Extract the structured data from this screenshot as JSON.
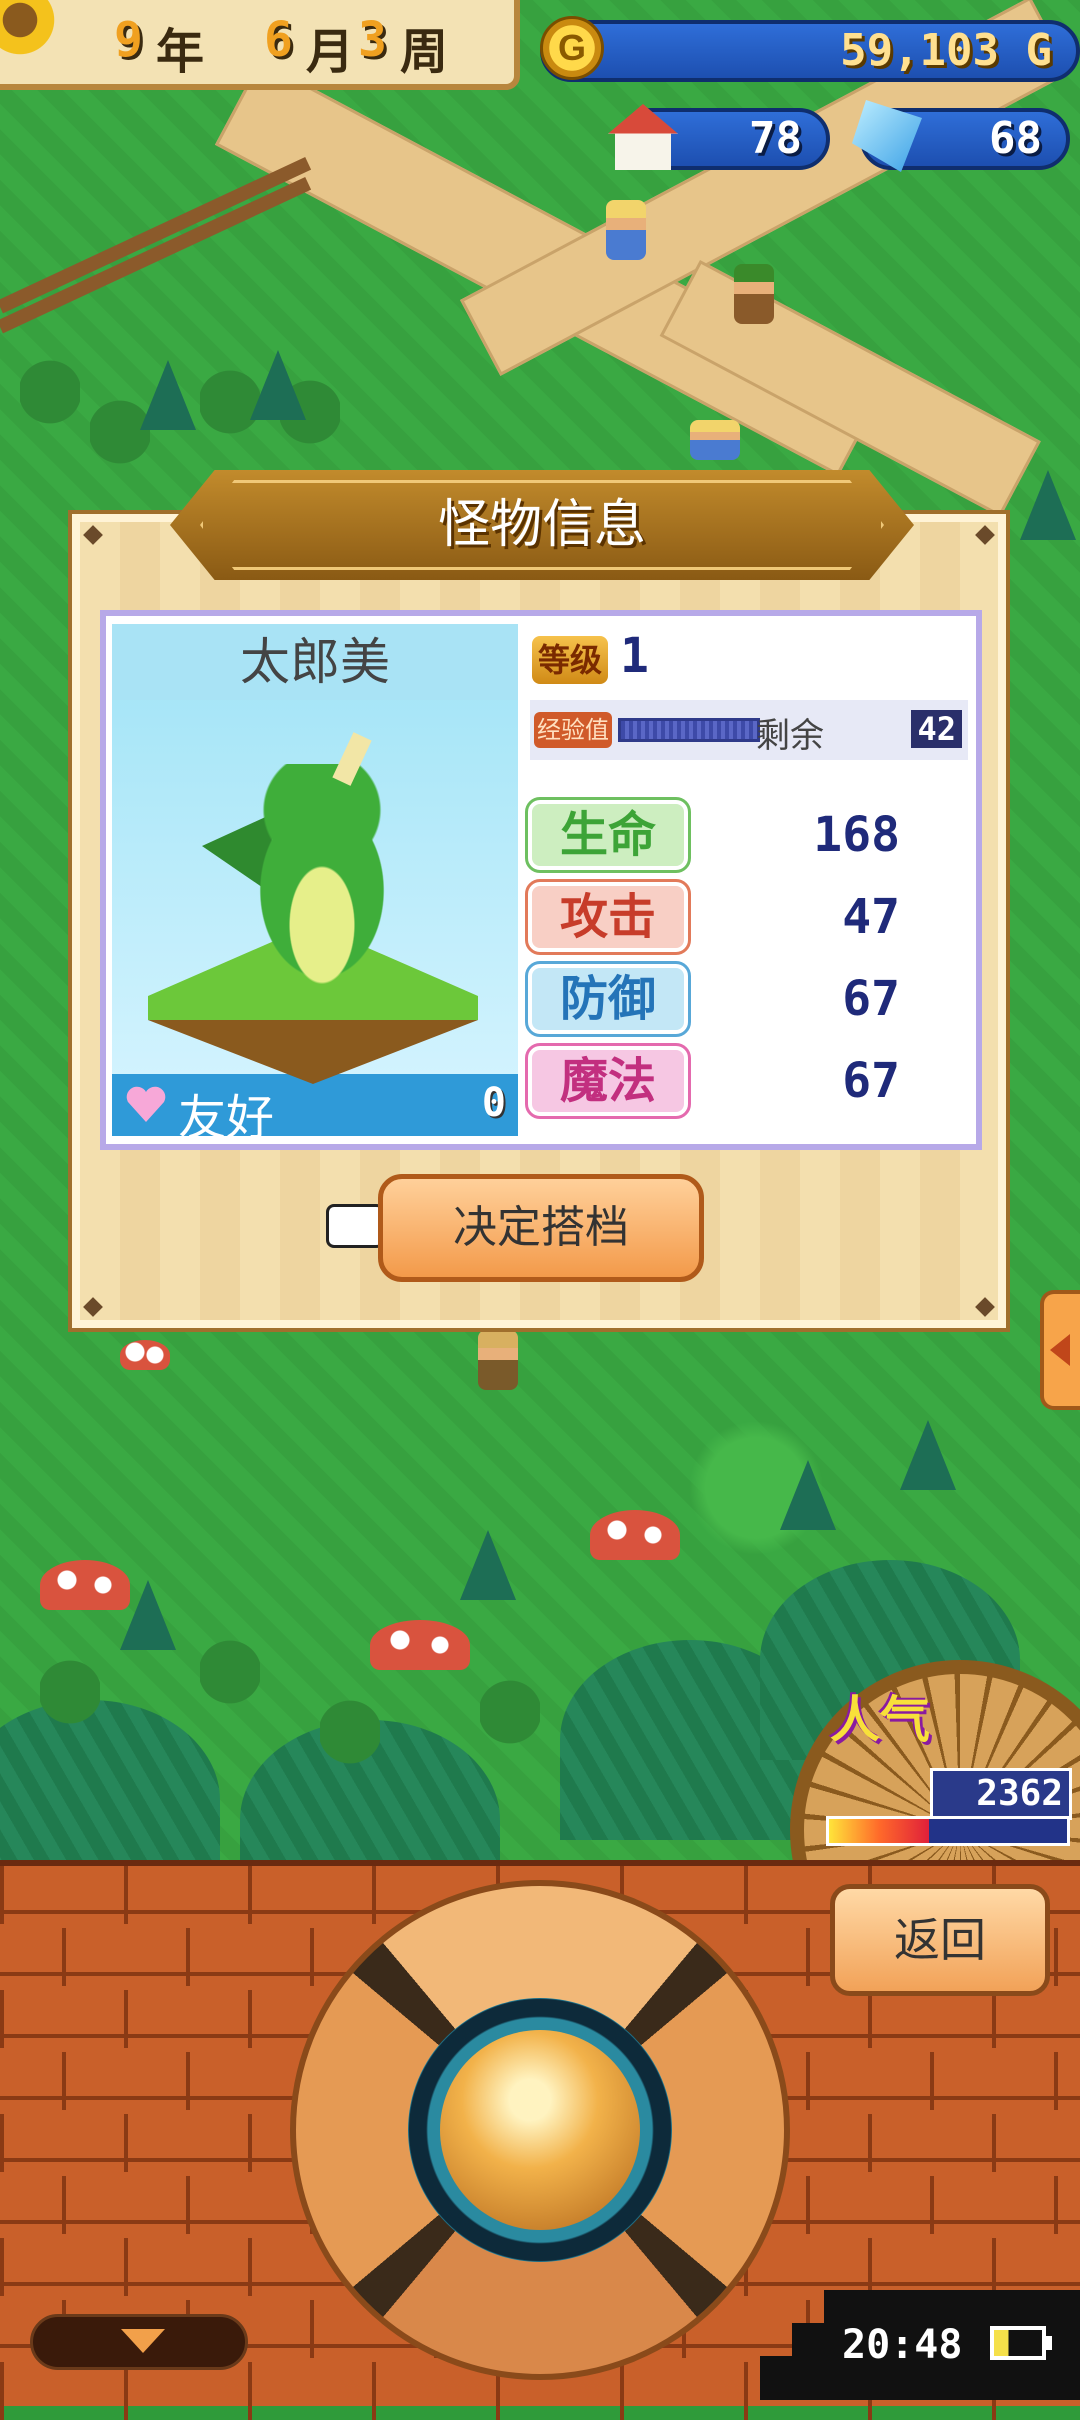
{
  "hud": {
    "year_num": "9",
    "year_unit": "年",
    "month_num": "6",
    "month_unit": "月",
    "week_num": "3",
    "week_unit": "周",
    "gold": "59,103 G",
    "gold_icon_letter": "G",
    "houses": "78",
    "crystals": "68"
  },
  "dialog": {
    "title": "怪物信息",
    "monster_name": "太郎美",
    "friend_label": "友好",
    "friend_value": "0",
    "level_label": "等级",
    "level_value": "1",
    "exp_label": "经验值",
    "exp_progress_pct": 100,
    "exp_remain_label": "剩余",
    "exp_remain_value": "42",
    "stats": [
      {
        "label": "生命",
        "value": "168"
      },
      {
        "label": "攻击",
        "value": "47"
      },
      {
        "label": "防御",
        "value": "67"
      },
      {
        "label": "魔法",
        "value": "67"
      }
    ],
    "confirm_label": "决定搭档"
  },
  "popularity": {
    "label": "人气",
    "value": "2362",
    "fill_pct": 42
  },
  "controls": {
    "back_label": "返回"
  },
  "status": {
    "clock": "20:48",
    "battery_pct": 30
  },
  "icons": {
    "sun": "sun-icon",
    "gold": "gold-coin-icon",
    "house": "house-icon",
    "crystal": "crystal-icon",
    "heart": "heart-icon",
    "pointer": "pointing-hand-icon",
    "side_arrow": "chevron-left-icon",
    "down_arrow": "chevron-down-icon",
    "battery": "battery-icon"
  },
  "colors": {
    "dialog_border": "#a06f2d",
    "title_banner": "#8a5a14",
    "stat_value": "#1f2a7a",
    "hp": "#3da437",
    "attack": "#c73c2a",
    "defense": "#2474b8",
    "magic": "#c22f7f",
    "brick": "#c9602a"
  }
}
